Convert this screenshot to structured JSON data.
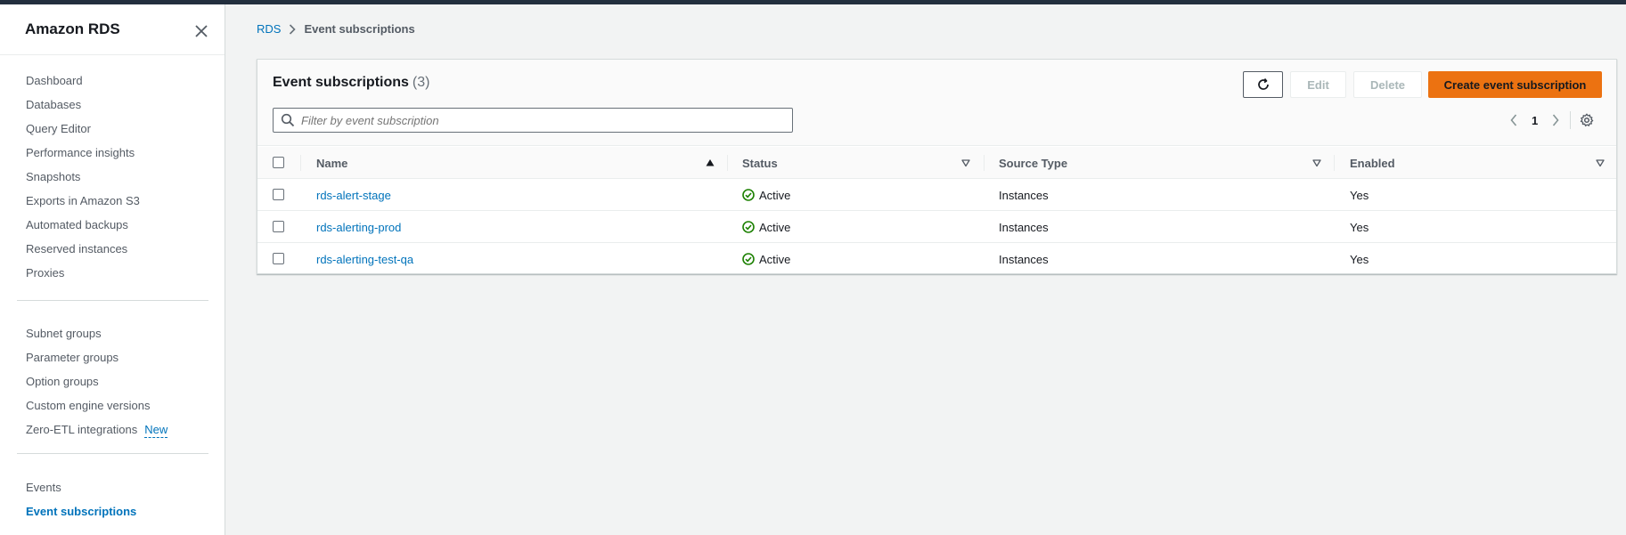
{
  "app": {
    "title": "Amazon RDS"
  },
  "sidebar": {
    "group1": [
      {
        "label": "Dashboard"
      },
      {
        "label": "Databases"
      },
      {
        "label": "Query Editor"
      },
      {
        "label": "Performance insights"
      },
      {
        "label": "Snapshots"
      },
      {
        "label": "Exports in Amazon S3"
      },
      {
        "label": "Automated backups"
      },
      {
        "label": "Reserved instances"
      },
      {
        "label": "Proxies"
      }
    ],
    "group2": [
      {
        "label": "Subnet groups"
      },
      {
        "label": "Parameter groups"
      },
      {
        "label": "Option groups"
      },
      {
        "label": "Custom engine versions"
      },
      {
        "label": "Zero-ETL integrations",
        "badge": "New"
      }
    ],
    "group3": [
      {
        "label": "Events"
      },
      {
        "label": "Event subscriptions",
        "active": true
      }
    ]
  },
  "breadcrumb": {
    "root": "RDS",
    "current": "Event subscriptions"
  },
  "panel": {
    "title": "Event subscriptions",
    "count": "(3)",
    "buttons": {
      "edit": "Edit",
      "delete": "Delete",
      "create": "Create event subscription"
    },
    "filter": {
      "placeholder": "Filter by event subscription"
    },
    "pager": {
      "page": "1"
    }
  },
  "table": {
    "columns": {
      "name": "Name",
      "status": "Status",
      "source_type": "Source Type",
      "enabled": "Enabled"
    },
    "rows": [
      {
        "name": "rds-alert-stage",
        "status": "Active",
        "source_type": "Instances",
        "enabled": "Yes"
      },
      {
        "name": "rds-alerting-prod",
        "status": "Active",
        "source_type": "Instances",
        "enabled": "Yes"
      },
      {
        "name": "rds-alerting-test-qa",
        "status": "Active",
        "source_type": "Instances",
        "enabled": "Yes"
      }
    ]
  },
  "colors": {
    "accent": "#0073bb",
    "primary_button": "#ec7211",
    "status_success": "#1d8102"
  },
  "icons": {
    "close": "close-icon",
    "breadcrumb_separator": "chevron-right-icon",
    "refresh": "refresh-icon",
    "search": "search-icon",
    "prev": "chevron-left-icon",
    "next": "chevron-right-icon",
    "settings": "gear-icon",
    "status": "check-circle-icon",
    "sort_asc": "sort-ascending-icon",
    "sort": "sort-icon"
  }
}
